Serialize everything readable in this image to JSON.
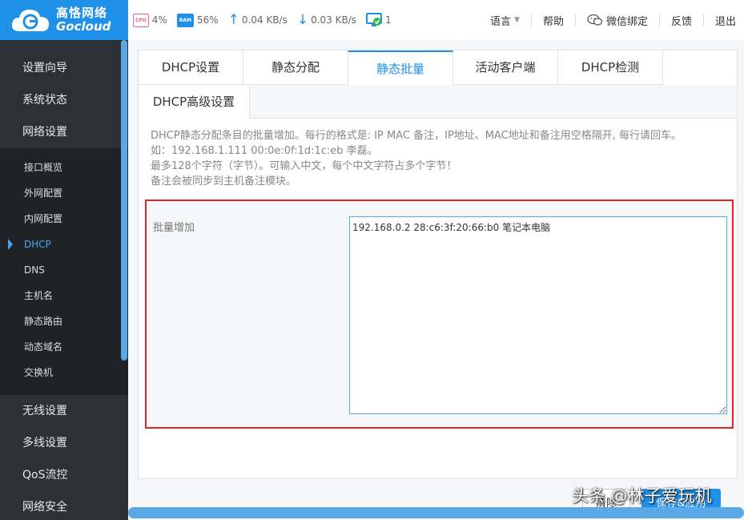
{
  "header": {
    "logo_cn": "高恪网络",
    "logo_en": "Gocloud",
    "cpu_label": "CPU",
    "cpu_value": "4%",
    "ram_label": "RAM",
    "ram_value": "56%",
    "upload": "0.04 KB/s",
    "download": "0.03 KB/s",
    "clients": "1",
    "menu": {
      "language": "语言",
      "help": "帮助",
      "wechat": "微信绑定",
      "feedback": "反馈",
      "logout": "退出"
    }
  },
  "sidebar": {
    "top_items": [
      "设置向导",
      "系统状态",
      "网络设置"
    ],
    "sub_items": [
      "接口概览",
      "外网配置",
      "内网配置",
      "DHCP",
      "DNS",
      "主机名",
      "静态路由",
      "动态域名",
      "交换机"
    ],
    "active_sub": "DHCP",
    "bottom_items": [
      "无线设置",
      "多线设置",
      "QoS流控",
      "网络安全"
    ]
  },
  "tabs": {
    "row1": [
      "DHCP设置",
      "静态分配",
      "静态批量",
      "活动客户端",
      "DHCP检测"
    ],
    "active": "静态批量",
    "row2": [
      "DHCP高级设置"
    ]
  },
  "description": {
    "line1": "DHCP静态分配条目的批量增加。每行的格式是: IP MAC 备注，IP地址、MAC地址和备注用空格隔开, 每行请回车。",
    "line2": "如：192.168.1.111 00:0e:0f:1d:1c:eb 李磊。",
    "line3": "最多128个字符（字节）。可输入中文，每个中文字符占多个字节！",
    "line4": "备注会被同步到主机备注模块。"
  },
  "form": {
    "label": "批量增加",
    "value": "192.168.0.2 28:c6:3f:20:66:b0 笔记本电脑\n"
  },
  "buttons": {
    "clear": "清除",
    "save": "保存&应用"
  },
  "watermark": "头条 @林子爱玩机",
  "colors": {
    "accent": "#1e90e8",
    "sidebar_bg": "#2c3138",
    "highlight_border": "#e0242c"
  }
}
